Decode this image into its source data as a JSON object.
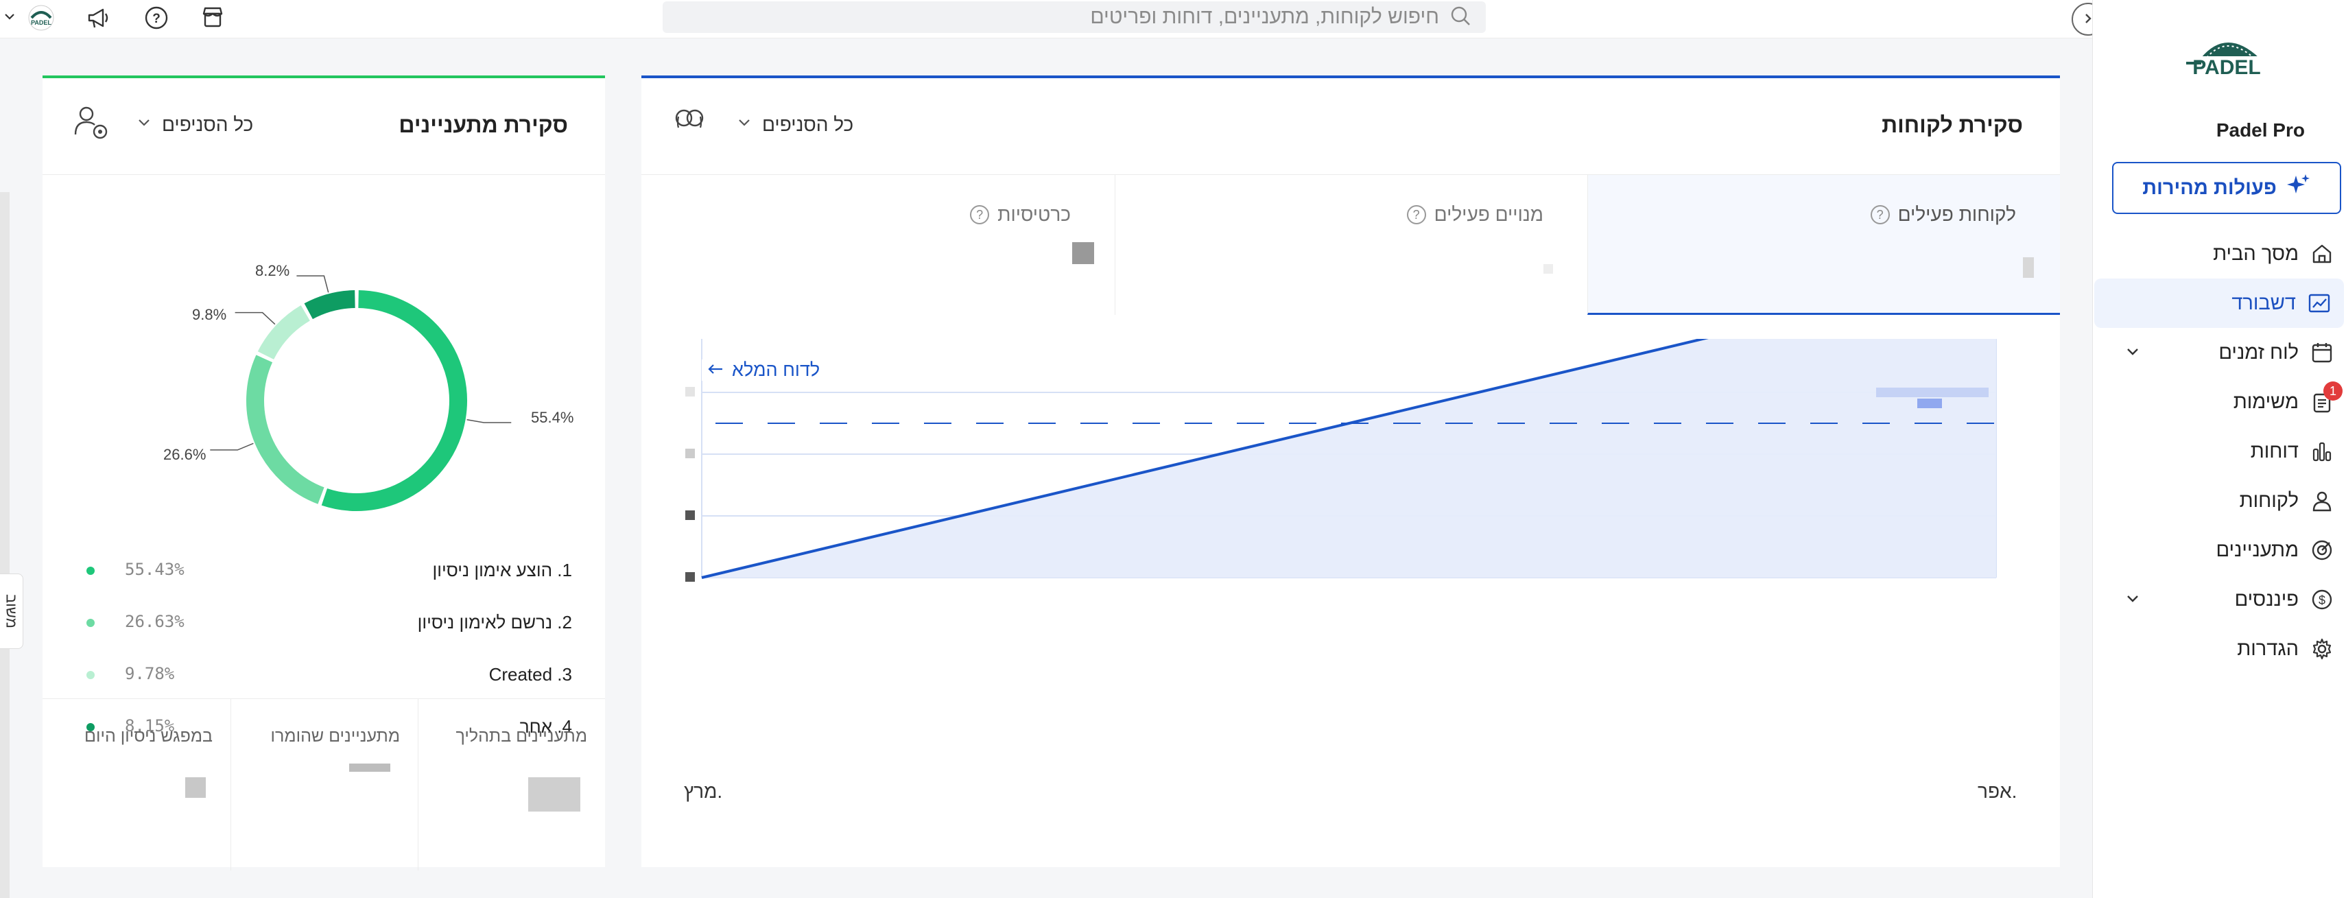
{
  "topbar": {
    "search_placeholder": "חיפוש לקוחות, מתעניינים, דוחות ופריטים",
    "icons": [
      "store-icon",
      "help-icon",
      "megaphone-icon",
      "padel-avatar-icon",
      "chevron-down-icon"
    ]
  },
  "sidebar": {
    "brand": "Padel Pro",
    "quick_actions": "פעולות מהירות",
    "items": [
      {
        "label": "מסך הבית",
        "icon": "home-icon",
        "active": false
      },
      {
        "label": "דשבורד",
        "icon": "chart-trend-icon",
        "active": true
      },
      {
        "label": "לוח זמנים",
        "icon": "calendar-icon",
        "active": false,
        "expandable": true
      },
      {
        "label": "משימות",
        "icon": "clipboard-icon",
        "active": false,
        "badge": "1"
      },
      {
        "label": "דוחות",
        "icon": "bar-chart-icon",
        "active": false
      },
      {
        "label": "לקוחות",
        "icon": "user-icon",
        "active": false
      },
      {
        "label": "מתעניינים",
        "icon": "target-icon",
        "active": false
      },
      {
        "label": "פיננסים",
        "icon": "dollar-icon",
        "active": false,
        "expandable": true
      },
      {
        "label": "הגדרות",
        "icon": "gear-icon",
        "active": false
      }
    ]
  },
  "clients_card": {
    "title": "סקירת לקוחות",
    "branch_select": "כל הסניפים",
    "tabs": [
      {
        "label": "לקוחות פעילים",
        "active": true
      },
      {
        "label": "מנויים פעילים",
        "active": false
      },
      {
        "label": "כרטיסיות",
        "active": false
      }
    ],
    "full_report_link": "לדוח המלא"
  },
  "leads_card": {
    "title": "סקירת מתעניינים",
    "branch_select": "כל הסניפים",
    "legend": [
      {
        "name": "1. הוצע אימון ניסיון",
        "pct": "55.43%",
        "color": "#1ec77a"
      },
      {
        "name": "2. נרשם לאימון ניסיון",
        "pct": "26.63%",
        "color": "#6ddba3"
      },
      {
        "name": "3. Created",
        "pct": "9.78%",
        "color": "#b9efd2"
      },
      {
        "name": "4. אחר",
        "pct": "8.15%",
        "color": "#0e9c62"
      }
    ],
    "bottom_stats": [
      "מתעניינים בתהליך",
      "מתעניינים שהומרו",
      "במפגש ניסיון היום"
    ],
    "side_tab": "משוב"
  },
  "chart_data": [
    {
      "type": "area",
      "x": [
        "מרץ.",
        "אפר."
      ],
      "series": [
        {
          "values": [
            0,
            5
          ]
        }
      ],
      "reference_line": 2.5,
      "ylim": [
        0,
        6
      ],
      "grid": true,
      "colors": {
        "line": "#1a55c8",
        "fill": "#e6ecfb"
      }
    },
    {
      "type": "pie",
      "categories": [
        "הוצע אימון ניסיון",
        "נרשם לאימון ניסיון",
        "Created",
        "אחר"
      ],
      "values": [
        55.43,
        26.63,
        9.78,
        8.15
      ],
      "labels": [
        "55.4%",
        "26.6%",
        "9.8%",
        "8.2%"
      ],
      "colors": [
        "#1ec77a",
        "#6ddba3",
        "#b9efd2",
        "#0e9c62"
      ]
    }
  ]
}
